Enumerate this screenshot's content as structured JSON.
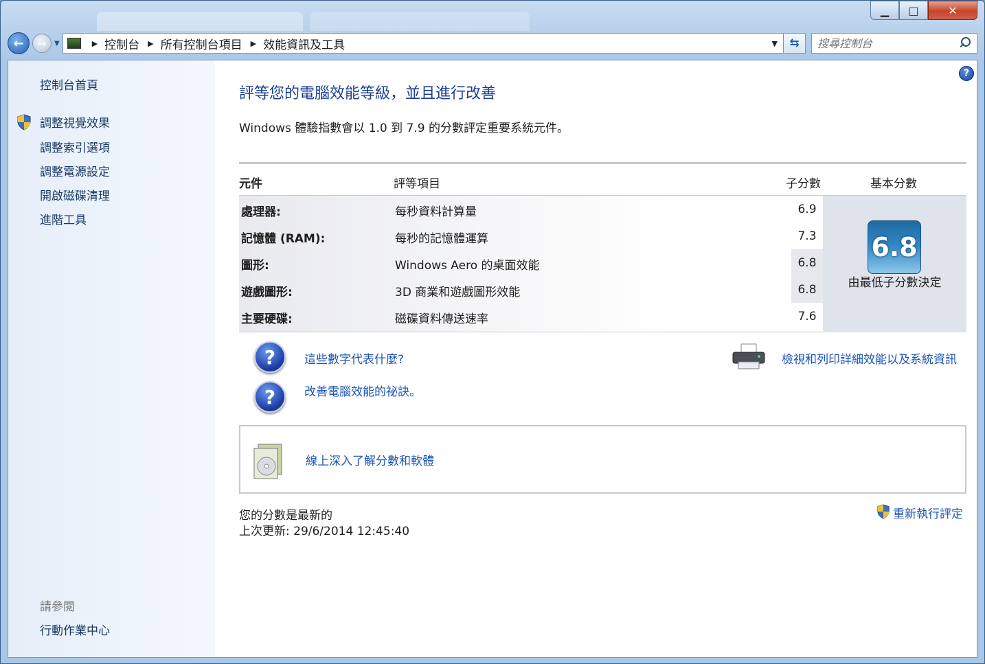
{
  "window": {
    "tabs_ghost": [
      "",
      ""
    ],
    "minimize_label": "▁",
    "maximize_label": "□",
    "close_label": "✕"
  },
  "address_bar": {
    "breadcrumbs": [
      "控制台",
      "所有控制台項目",
      "效能資訊及工具"
    ],
    "search_placeholder": "搜尋控制台"
  },
  "sidebar": {
    "home": "控制台首頁",
    "items": [
      "調整視覺效果",
      "調整索引選項",
      "調整電源設定",
      "開啟磁碟清理",
      "進階工具"
    ],
    "see_also_title": "請參閱",
    "see_also_items": [
      "行動作業中心"
    ]
  },
  "main": {
    "title": "評等您的電腦效能等級，並且進行改善",
    "subtitle": "Windows 體驗指數會以 1.0 到 7.9 的分數評定重要系統元件。",
    "table": {
      "headers": {
        "component": "元件",
        "rating": "評等項目",
        "subscore": "子分數",
        "basescore": "基本分數"
      },
      "rows": [
        {
          "component": "處理器:",
          "rating": "每秒資料計算量",
          "subscore": "6.9"
        },
        {
          "component": "記憶體 (RAM):",
          "rating": "每秒的記憶體運算",
          "subscore": "7.3"
        },
        {
          "component": "圖形:",
          "rating": "Windows Aero 的桌面效能",
          "subscore": "6.8"
        },
        {
          "component": "遊戲圖形:",
          "rating": "3D 商業和遊戲圖形效能",
          "subscore": "6.8"
        },
        {
          "component": "主要硬碟:",
          "rating": "磁碟資料傳送速率",
          "subscore": "7.6"
        }
      ],
      "base_score": "6.8",
      "base_caption": "由最低子分數決定"
    },
    "links": {
      "what_numbers": "這些數字代表什麼?",
      "tips": "改善電腦效能的祕訣。",
      "print_details": "檢視和列印詳細效能以及系統資訊",
      "online": "線上深入了解分數和軟體",
      "rerun": "重新執行評定"
    },
    "status": {
      "current": "您的分數是最新的",
      "last_update": "上次更新: 29/6/2014 12:45:40"
    }
  }
}
